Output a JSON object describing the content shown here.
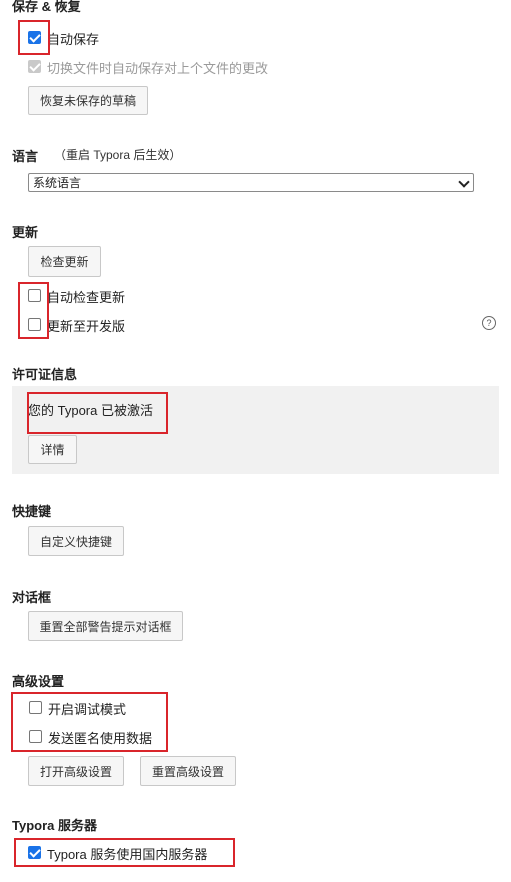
{
  "save": {
    "title": "保存 & 恢复",
    "autosave_label": "自动保存",
    "autosave_checked": true,
    "autosave_switch_label": "切换文件时自动保存对上个文件的更改",
    "restore_button": "恢复未保存的草稿"
  },
  "language": {
    "title": "语言",
    "hint": "（重启 Typora 后生效）",
    "selected": "系统语言"
  },
  "update": {
    "title": "更新",
    "check_button": "检查更新",
    "auto_check_label": "自动检查更新",
    "dev_label": "更新至开发版",
    "help_icon": "question-circle-icon"
  },
  "license": {
    "title": "许可证信息",
    "status": "您的 Typora 已被激活",
    "details_button": "详情"
  },
  "shortcuts": {
    "title": "快捷键",
    "custom_button": "自定义快捷键"
  },
  "dialogs": {
    "title": "对话框",
    "reset_button": "重置全部警告提示对话框"
  },
  "advanced": {
    "title": "高级设置",
    "debug_label": "开启调试模式",
    "anon_label": "发送匿名使用数据",
    "open_button": "打开高级设置",
    "reset_button": "重置高级设置"
  },
  "server": {
    "title": "Typora 服务器",
    "domestic_label": "Typora 服务使用国内服务器",
    "domestic_checked": true
  },
  "colors": {
    "highlight_box": "#d9252b",
    "checkbox_accent": "#1a73e8"
  }
}
